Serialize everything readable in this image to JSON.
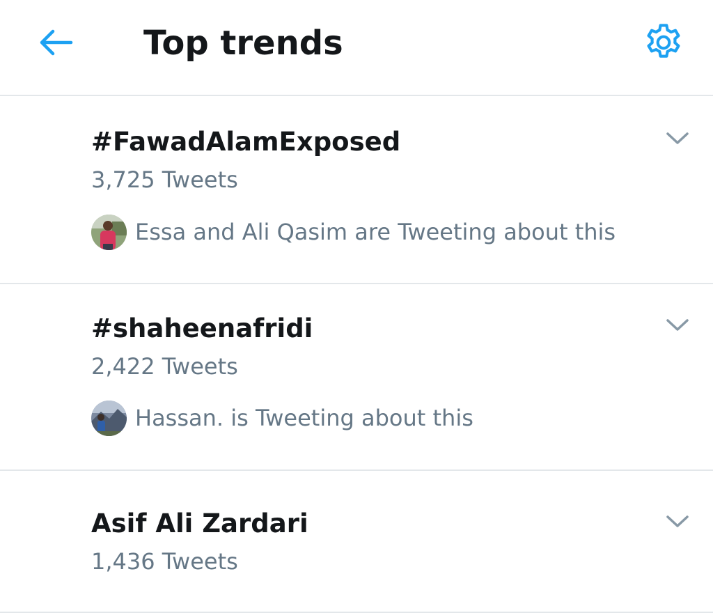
{
  "header": {
    "title": "Top trends",
    "back_icon": "arrow-left-icon",
    "settings_icon": "gear-icon",
    "accent_color": "#1da1f2"
  },
  "trends": [
    {
      "name": "#FawadAlamExposed",
      "count": "3,725 Tweets",
      "context": "Essa and Ali Qasim are Tweeting about this",
      "has_context": true
    },
    {
      "name": "#shaheenafridi",
      "count": "2,422 Tweets",
      "context": "Hassan. is Tweeting about this",
      "has_context": true
    },
    {
      "name": "Asif Ali Zardari",
      "count": "1,436 Tweets",
      "has_context": false
    }
  ],
  "colors": {
    "text_primary": "#14171a",
    "text_secondary": "#657786",
    "divider": "#e3e7ea",
    "chevron": "#8899a6"
  }
}
